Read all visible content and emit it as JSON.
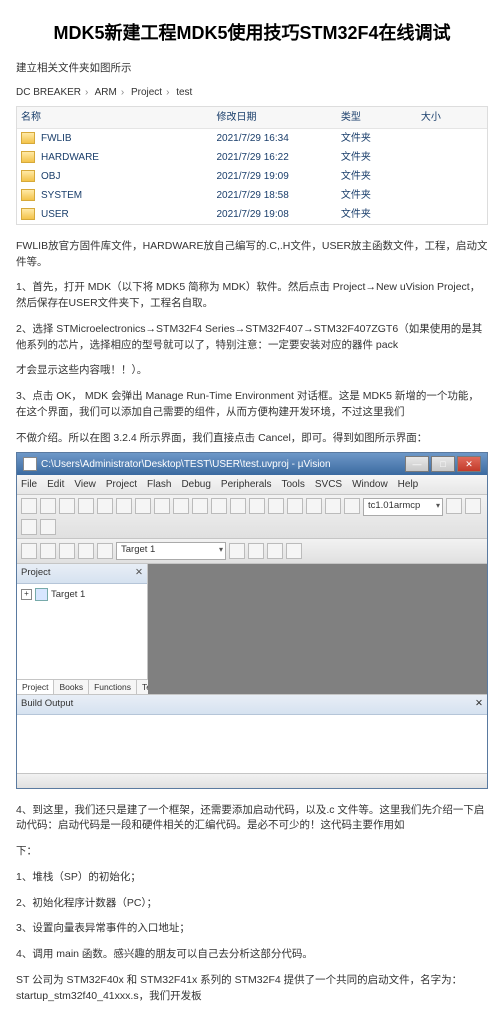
{
  "title": "MDK5新建工程MDK5使用技巧STM32F4在线调试",
  "intro": "建立相关文件夹如图所示",
  "breadcrumb": [
    "DC BREAKER",
    "ARM",
    "Project",
    "test"
  ],
  "folder_table": {
    "headers": {
      "name": "名称",
      "date": "修改日期",
      "type": "类型",
      "size": "大小"
    },
    "rows": [
      {
        "name": "FWLIB",
        "date": "2021/7/29 16:34",
        "type": "文件夹"
      },
      {
        "name": "HARDWARE",
        "date": "2021/7/29 16:22",
        "type": "文件夹"
      },
      {
        "name": "OBJ",
        "date": "2021/7/29 19:09",
        "type": "文件夹"
      },
      {
        "name": "SYSTEM",
        "date": "2021/7/29 18:58",
        "type": "文件夹"
      },
      {
        "name": "USER",
        "date": "2021/7/29 19:08",
        "type": "文件夹"
      }
    ]
  },
  "p_fwlib": "FWLIB放官方固件库文件，HARDWARE放自己编写的.C,.H文件，USER放主函数文件，工程，启动文件等。",
  "p1": "1、首先，打开 MDK（以下将 MDK5 简称为 MDK）软件。然后点击 Project→New uVision Project，然后保存在USER文件夹下，工程名自取。",
  "p2": "2、选择 STMicroelectronics→STM32F4 Series→STM32F407→STM32F407ZGT6（如果使用的是其他系列的芯片，选择相应的型号就可以了，特别注意：一定要安装对应的器件 pack",
  "p2b": "才会显示这些内容哦！！）。",
  "p3": "3、点击 OK， MDK 会弹出 Manage Run-Time Environment 对话框。这是 MDK5 新增的一个功能，在这个界面，我们可以添加自己需要的组件，从而方便构建开发环境，不过这里我们",
  "p3b": "不做介绍。所以在图 3.2.4 所示界面，我们直接点击 Cancel，即可。得到如图所示界面：",
  "ide": {
    "title": "C:\\Users\\Administrator\\Desktop\\TEST\\USER\\test.uvproj - µVision",
    "menu": [
      "File",
      "Edit",
      "View",
      "Project",
      "Flash",
      "Debug",
      "Peripherals",
      "Tools",
      "SVCS",
      "Window",
      "Help"
    ],
    "toolbar2": {
      "target_combo": "Target 1",
      "tc_combo": "tc1.01armcp"
    },
    "project_pane": {
      "title": "Project",
      "root": "Target 1"
    },
    "pane_tabs": [
      "Project",
      "Books",
      "Functions",
      "Templates"
    ],
    "output_title": "Build Output"
  },
  "p4": "4、到这里，我们还只是建了一个框架，还需要添加启动代码，以及.c 文件等。这里我们先介绍一下启动代码：启动代码是一段和硬件相关的汇编代码。是必不可少的！这代码主要作用如",
  "p4b": "下：",
  "li1": "1、堆栈（SP）的初始化；",
  "li2": "2、初始化程序计数器（PC）；",
  "li3": "3、设置向量表异常事件的入口地址；",
  "li4": "4、调用 main 函数。感兴趣的朋友可以自己去分析这部分代码。",
  "p5": "ST 公司为 STM32F40x 和 STM32F41x 系列的 STM32F4 提供了一个共同的启动文件，名字为： startup_stm32f40_41xxx.s，我们开发板"
}
